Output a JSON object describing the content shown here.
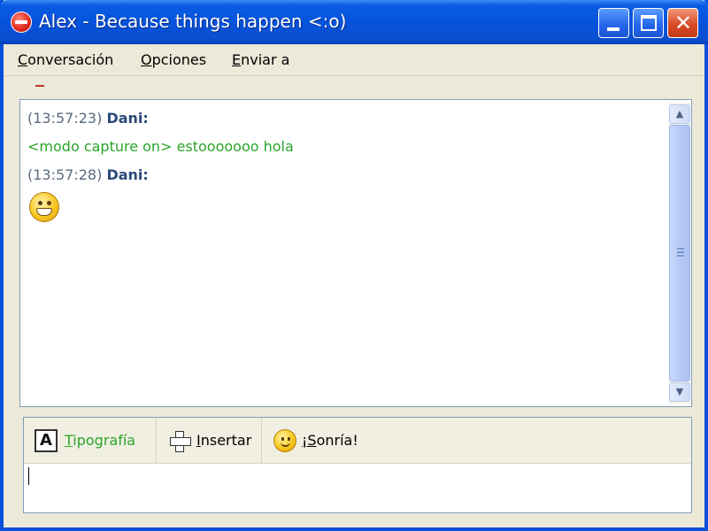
{
  "window": {
    "title": "Alex - Because things happen <:o)"
  },
  "menu": [
    {
      "first": "C",
      "rest": "onversación"
    },
    {
      "first": "O",
      "rest": "pciones"
    },
    {
      "first": "E",
      "rest": "nviar a"
    }
  ],
  "chat": {
    "messages": [
      {
        "timestamp": "(13:57:23)",
        "sender": "Dani:",
        "text": "<modo capture on> estooooooo hola"
      },
      {
        "timestamp": "(13:57:28)",
        "sender": "Dani:",
        "emoticon": "grin-smiley-icon"
      }
    ],
    "text_color": "#2aa52a"
  },
  "toolbar": {
    "font": {
      "first": "T",
      "rest": "ipografía"
    },
    "insert": {
      "first": "I",
      "rest": "nsertar"
    },
    "smile": {
      "first": "¡S",
      "rest": "onría!"
    }
  },
  "compose": {
    "value": ""
  },
  "colors": {
    "titlebar": "#0553dc",
    "accent_green": "#2aa52a",
    "nick": "#2c4a7a"
  }
}
